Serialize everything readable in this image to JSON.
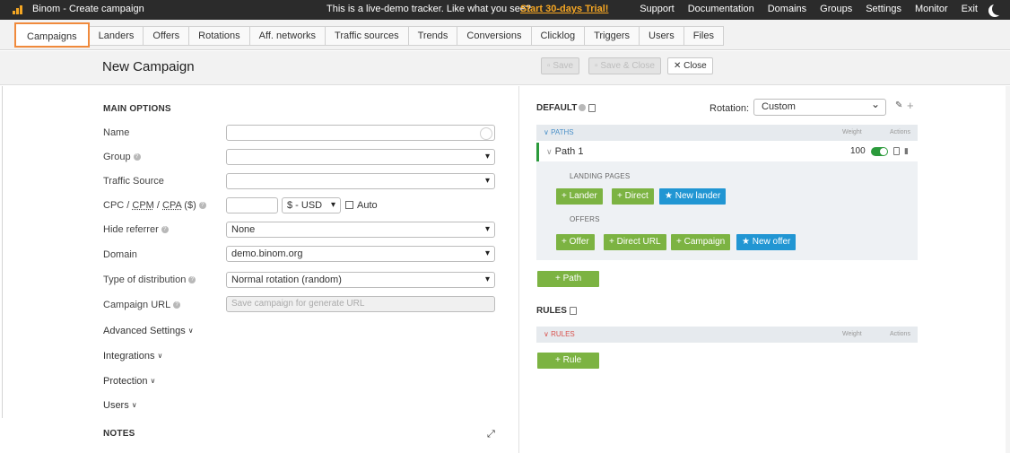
{
  "topbar": {
    "app_title": "Binom - Create campaign",
    "demo_text": "This is a live-demo tracker. Like what you see?",
    "trial_link": "Start 30-days Trial!",
    "nav": [
      "Support",
      "Documentation",
      "Domains",
      "Groups",
      "Settings",
      "Monitor",
      "Exit"
    ]
  },
  "tabs": [
    "Campaigns",
    "Landers",
    "Offers",
    "Rotations",
    "Aff. networks",
    "Traffic sources",
    "Trends",
    "Conversions",
    "Clicklog",
    "Triggers",
    "Users",
    "Files"
  ],
  "header": {
    "title": "New Campaign",
    "save": "Save",
    "save_close": "Save & Close",
    "close": "Close"
  },
  "form": {
    "main_options": "MAIN OPTIONS",
    "name_label": "Name",
    "name_value": "",
    "group_label": "Group",
    "group_value": "",
    "traffic_source_label": "Traffic Source",
    "traffic_source_value": "",
    "cpc_label_cpc": "CPC",
    "cpc_label_cpm": "CPM",
    "cpc_label_cpa": "CPA",
    "cpc_label_unit": "($)",
    "cpc_value": "",
    "currency_value": "$ - USD",
    "auto_label": "Auto",
    "hide_referrer_label": "Hide referrer",
    "hide_referrer_value": "None",
    "domain_label": "Domain",
    "domain_value": "demo.binom.org",
    "distribution_label": "Type of distribution",
    "distribution_value": "Normal rotation (random)",
    "campaign_url_label": "Campaign URL",
    "campaign_url_placeholder": "Save campaign for generate URL",
    "advanced_settings": "Advanced Settings",
    "integrations": "Integrations",
    "protection": "Protection",
    "users": "Users",
    "notes": "NOTES"
  },
  "rotation_panel": {
    "title": "DEFAULT",
    "rotation_label": "Rotation:",
    "rotation_value": "Custom",
    "paths_header": "PATHS",
    "weight_header": "Weight",
    "actions_header": "Actions",
    "path_name": "Path 1",
    "path_weight": "100",
    "landing_pages_label": "LANDING PAGES",
    "offers_label": "OFFERS",
    "btn_lander": "+ Lander",
    "btn_direct": "+ Direct",
    "btn_new_lander": "★ New lander",
    "btn_offer": "+ Offer",
    "btn_direct_url": "+ Direct URL",
    "btn_campaign": "+ Campaign",
    "btn_new_offer": "★ New offer",
    "btn_path": "+ Path",
    "rules_title": "RULES",
    "rules_header": "RULES",
    "btn_rule": "+ Rule"
  },
  "colors": {
    "topbar_bg": "#2b2b2b",
    "active_tab_border": "#f08a3c",
    "trial_link": "#f5a623",
    "green_button": "#7cb342",
    "blue_button": "#2196d3",
    "path_indicator": "#2b9a3b"
  }
}
